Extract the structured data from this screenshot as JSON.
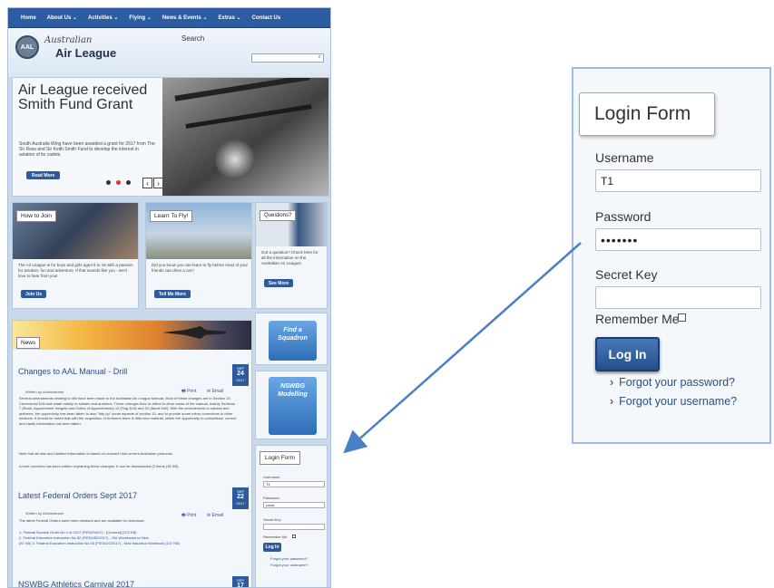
{
  "nav": {
    "items": [
      "Home",
      "About Us ⌄",
      "Activities ⌄",
      "Flying ⌄",
      "News & Events ⌄",
      "Extras ⌄",
      "Contact Us"
    ]
  },
  "header": {
    "logo_badge": "AAL",
    "logo_script": "Australian",
    "logo_main": "Air League",
    "search_label": "Search"
  },
  "hero": {
    "title": "Air League received Smith Fund Grant",
    "text": "South Australia Wing have been awarded a grant for 2017 from The Sir Ross and Sir Keith Smith Fund to develop the interest in aviation of its cadets.",
    "button": "Read More",
    "prev": "‹",
    "next": "›"
  },
  "cards": {
    "join": {
      "label": "How to Join",
      "text": "The Air League is for boys and girls aged 8 to 18 with a passion for aviation, fun and adventure. If that sounds like you - we'd love to hear from you!",
      "button": "Join Us"
    },
    "fly": {
      "label": "Learn To Fly!",
      "text": "Did you know you can learn to fly before most of your friends can drive a car?",
      "button": "Tell Me More"
    },
    "questions": {
      "label": "Questions?",
      "text": "Got a question? Check here for all the information on the Australian Air League!",
      "button": "See More"
    }
  },
  "news": {
    "label": "News",
    "articles": [
      {
        "title": "Changes to AAL Manual - Drill",
        "month": "SEP",
        "day": "24",
        "year": "2017",
        "meta": "Written by Administrator",
        "print": "Print",
        "email": "Email",
        "body": "Several amendments relating to drill have been made to the Australian Air League Manual. Most of these changes are in Section 10, Ceremonial Drill and relate mainly to salutes and anthems. These changes flow on effect to other areas of the manual, mainly Sections 7 (Rank, Appointment Insignia and Duties of Appointments) 15 (Flag Drill) and 20 (Band Drill). With the amendments to salutes and anthems, the opportunity has been taken to also \"tidy up\" some aspects of section 10, and to provide some minor corrections in other sections. It should be noted that with the acquisition of Anthems there is little new material, rather the opportunity to consolidate, correct and clarify information has been taken.",
        "body2": "Note that all new and clarified information is based on research into current Australian protocols.",
        "body3": "A brief overview has been written explaining these changes. It can be downloaded (3 Items (35 KB)."
      },
      {
        "title": "Latest Federal Orders Sept 2017",
        "month": "SEP",
        "day": "22",
        "year": "2017",
        "meta": "Written by Administrator",
        "print": "Print",
        "email": "Email",
        "body": "The latest Federal Orders have been released and are available for download:",
        "files": [
          "1. Federal Routine Order No 4 of 2017 (F/RO/04/17) - [General] (123 KB)",
          "2. Federal Education Instruction No 52 (F/EDU52/2017) - Old Workbooks to New",
          "(87 KB)  3. Federal Education Instruction No 53 (F/EDU/2/2017) - New Induction Workbook (107 KB)"
        ]
      },
      {
        "title": "NSWBG Athletics Carnival 2017",
        "month": "SEP",
        "day": "17",
        "year": "2017"
      }
    ]
  },
  "side": {
    "squadron": "Find a Squadron",
    "modelling": "NSWBG Modelling"
  },
  "login_form": {
    "title": "Login Form",
    "username_label": "Username",
    "username_value": "T1",
    "password_label": "Password",
    "password_value": "•••••••",
    "secret_label": "Secret Key",
    "secret_value": "",
    "remember_label": "Remember Me",
    "button": "Log In",
    "forgot_password": "Forgot your password?",
    "forgot_username": "Forgot your username?",
    "link_chevron": "›"
  },
  "colors": {
    "nav": "#2d5ca2",
    "button": "#2c5a9a",
    "link": "#2b4f86",
    "arrow": "#4a7ec6"
  }
}
